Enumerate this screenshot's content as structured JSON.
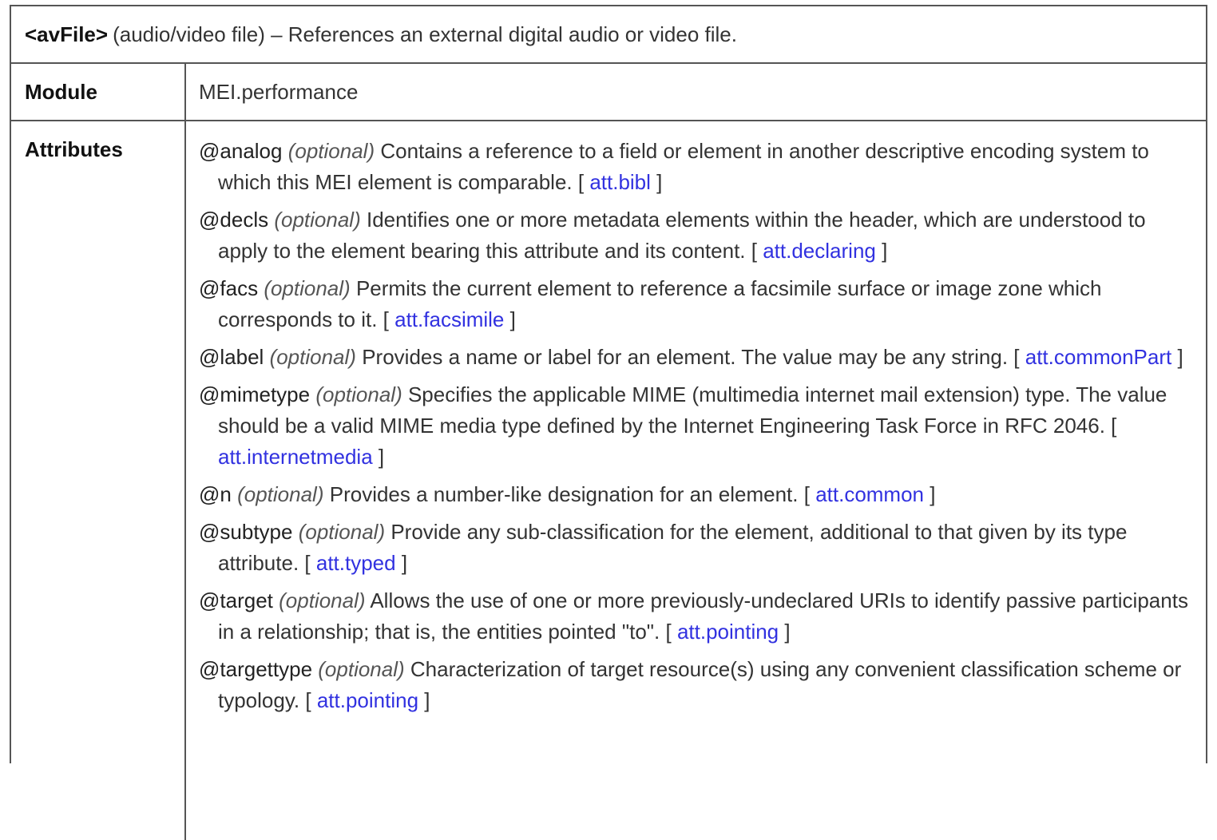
{
  "element": {
    "name": "<avFile>",
    "gloss": "(audio/video file) – References an external digital audio or video file."
  },
  "module": {
    "label": "Module",
    "value": "MEI.performance"
  },
  "attributes": {
    "label": "Attributes",
    "items": [
      {
        "name": "@analog",
        "optional": "(optional)",
        "desc": "Contains a reference to a field or element in another descriptive encoding system to which this MEI element is comparable.",
        "class": "att.bibl"
      },
      {
        "name": "@decls",
        "optional": "(optional)",
        "desc": "Identifies one or more metadata elements within the header, which are understood to apply to the element bearing this attribute and its content.",
        "class": "att.declaring"
      },
      {
        "name": "@facs",
        "optional": "(optional)",
        "desc": "Permits the current element to reference a facsimile surface or image zone which corresponds to it.",
        "class": "att.facsimile"
      },
      {
        "name": "@label",
        "optional": "(optional)",
        "desc": "Provides a name or label for an element. The value may be any string.",
        "class": "att.commonPart"
      },
      {
        "name": "@mimetype",
        "optional": "(optional)",
        "desc": "Specifies the applicable MIME (multimedia internet mail extension) type. The value should be a valid MIME media type defined by the Internet Engineering Task Force in RFC 2046.",
        "class": "att.internetmedia"
      },
      {
        "name": "@n",
        "optional": "(optional)",
        "desc": "Provides a number-like designation for an element.",
        "class": "att.common"
      },
      {
        "name": "@subtype",
        "optional": "(optional)",
        "desc": "Provide any sub-classification for the element, additional to that given by its type attribute.",
        "class": "att.typed"
      },
      {
        "name": "@target",
        "optional": "(optional)",
        "desc": "Allows the use of one or more previously-undeclared URIs to identify passive participants in a relationship; that is, the entities pointed \"to\".",
        "class": "att.pointing"
      },
      {
        "name": "@targettype",
        "optional": "(optional)",
        "desc": "Characterization of target resource(s) using any convenient classification scheme or typology.",
        "class": "att.pointing"
      }
    ]
  },
  "colors": {
    "link": "#3131e0",
    "border": "#555555",
    "text": "#333333"
  }
}
